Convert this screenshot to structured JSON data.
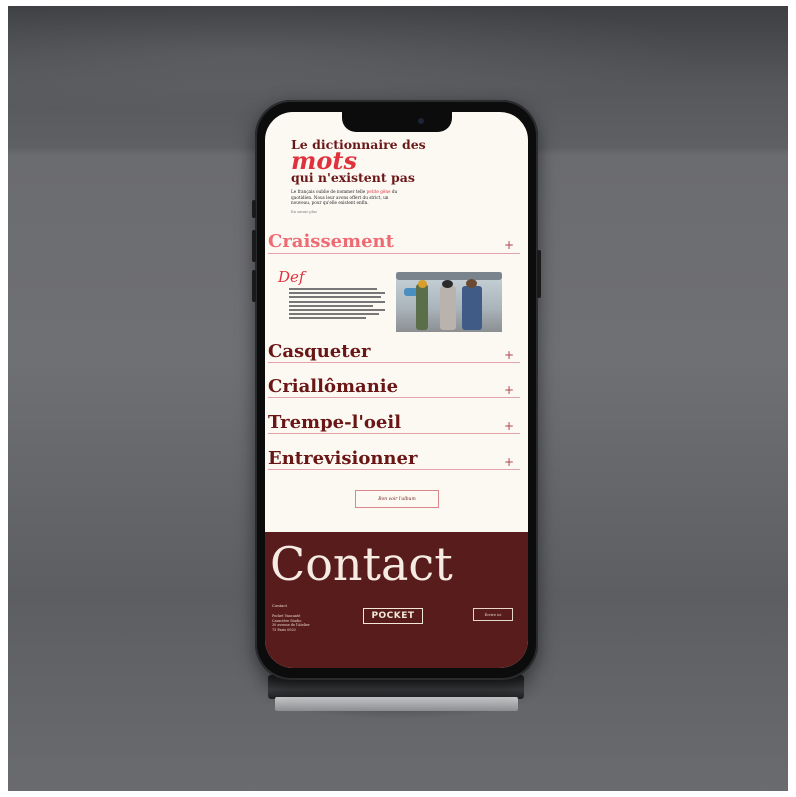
{
  "hero": {
    "title_line1": "Le dictionnaire des",
    "title_word": "mots",
    "title_line3": "qui n'existent pas",
    "intro_start": "Le français oublie de nommer telle",
    "intro_accent": "petite gêne",
    "intro_end": "du quotidien. Nous leur avons offert du strict, un nouveau, pour qu'elle existent enfin.",
    "small_link": "En savoir plus"
  },
  "entries": [
    {
      "word": "Craissement",
      "icon": "plus-icon",
      "expanded": true
    },
    {
      "word": "Casqueter",
      "icon": "plus-icon",
      "expanded": false
    },
    {
      "word": "Criallômanie",
      "icon": "plus-icon",
      "expanded": false
    },
    {
      "word": "Trempe-l'oeil",
      "icon": "plus-icon",
      "expanded": false
    },
    {
      "word": "Entrevisionner",
      "icon": "plus-icon",
      "expanded": false
    }
  ],
  "plus_symbol": "+",
  "definition": {
    "label": "Def"
  },
  "see_all": "Bon voir l'album",
  "footer": {
    "title": "Contact",
    "label": "Contact",
    "address_lines": [
      "Pocket Vancanté",
      "Caractère Studio",
      "30 avenue de l'Atelier",
      "75 Paris 0020"
    ],
    "logo": "POCKET",
    "cta": "Écrire ici"
  },
  "colors": {
    "accent": "#e0323d",
    "accent_soft": "#ef6b74",
    "burgundy": "#6a1616",
    "footer_bg": "#591c1c",
    "page_bg": "#fcf9f3"
  }
}
